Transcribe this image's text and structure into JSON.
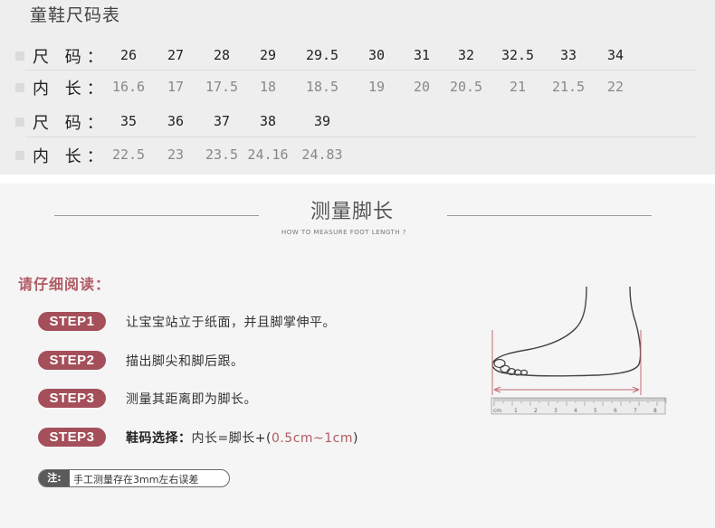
{
  "size_table": {
    "title": "童鞋尺码表",
    "rows": [
      {
        "label": "尺 码：",
        "kind": "size",
        "values": [
          "26",
          "27",
          "28",
          "29",
          "29.5",
          "30",
          "31",
          "32",
          "32.5",
          "33",
          "34"
        ]
      },
      {
        "label": "内 长：",
        "kind": "len",
        "values": [
          "16.6",
          "17",
          "17.5",
          "18",
          "18.5",
          "19",
          "20",
          "20.5",
          "21",
          "21.5",
          "22"
        ]
      },
      {
        "label": "尺 码：",
        "kind": "size",
        "values": [
          "35",
          "36",
          "37",
          "38",
          "39"
        ]
      },
      {
        "label": "内 长：",
        "kind": "len",
        "values": [
          "22.5",
          "23",
          "23.5",
          "24.16",
          "24.83"
        ]
      }
    ]
  },
  "measure": {
    "title": "测量脚长",
    "subtitle": "HOW TO MEASURE FOOT LENGTH ?",
    "read_title": "请仔细阅读：",
    "steps": [
      {
        "badge": "STEP1",
        "text": "让宝宝站立于纸面，并且脚掌伸平。"
      },
      {
        "badge": "STEP2",
        "text": "描出脚尖和脚后跟。"
      },
      {
        "badge": "STEP3",
        "text": "测量其距离即为脚长。"
      },
      {
        "badge": "STEP3",
        "bold": "鞋码选择：",
        "text": "内长=脚长+(",
        "accent": "0.5cm~1cm",
        "end": ")"
      }
    ],
    "note": {
      "tag": "注:",
      "text": "手工测量存在3mm左右误差"
    },
    "ruler": {
      "unit": "cm",
      "numbers": [
        "1",
        "2",
        "3",
        "4",
        "5",
        "6",
        "7",
        "8"
      ]
    },
    "colors": {
      "accent": "#a44f5a",
      "accent_text": "#b05a63",
      "note_tag": "#5a5a5a"
    }
  }
}
